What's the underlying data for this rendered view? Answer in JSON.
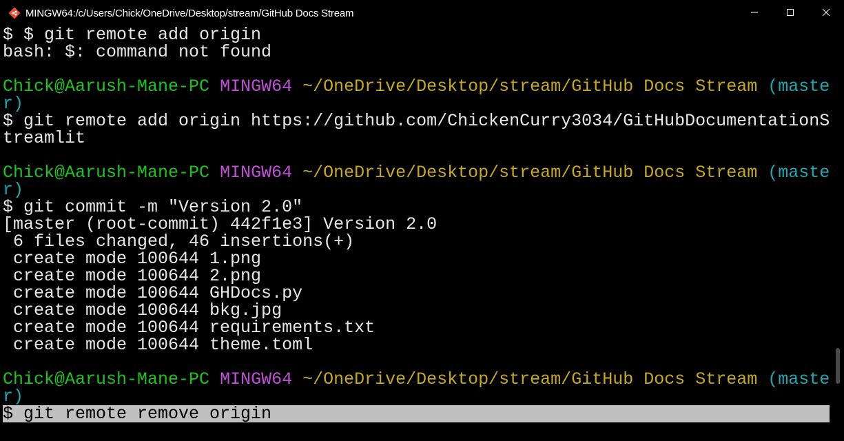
{
  "window": {
    "title": "MINGW64:/c/Users/Chick/OneDrive/Desktop/stream/GitHub Docs Stream",
    "icon": "git-bash-icon"
  },
  "controls": {
    "minimize": "minimize-icon",
    "maximize": "maximize-icon",
    "close": "close-icon"
  },
  "colors": {
    "user_host": "#1cc41c",
    "shell": "#c24fd8",
    "path": "#c6a91b",
    "branch": "#1ca8b1",
    "cursor_line_bg": "#c0c0c0"
  },
  "terminal": {
    "line_1": "$ $ git remote add origin",
    "line_2": "bash: $: command not found",
    "prompt": {
      "user": "Chick@Aarush-Mane-PC",
      "shell": "MINGW64",
      "path": "~/OneDrive/Desktop/stream/GitHub Docs Stream",
      "branch_start": "(maste",
      "branch_end": "r)"
    },
    "cmd_remote_add_a": "$ git remote add origin https://github.com/ChickenCurry3034/GitHubDocumentationS",
    "cmd_remote_add_b": "treamlit",
    "cmd_commit": "$ git commit -m \"Version 2.0\"",
    "commit_out": [
      "[master (root-commit) 442f1e3] Version 2.0",
      " 6 files changed, 46 insertions(+)",
      " create mode 100644 1.png",
      " create mode 100644 2.png",
      " create mode 100644 GHDocs.py",
      " create mode 100644 bkg.jpg",
      " create mode 100644 requirements.txt",
      " create mode 100644 theme.toml"
    ],
    "cmd_current": "$ git remote remove origin"
  }
}
